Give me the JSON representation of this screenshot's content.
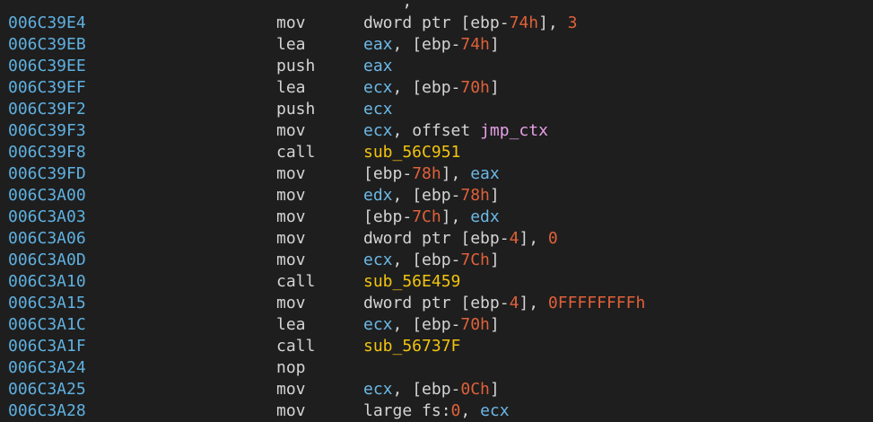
{
  "colors": {
    "background": "#1e1e1e",
    "address": "#5fb0e0",
    "mnemonic": "#d4d4d4",
    "register": "#6cb8e6",
    "number": "#e0613a",
    "subroutine": "#f2c40f",
    "symbol": "#e6a0e6"
  },
  "disasm": {
    "lines": [
      {
        "addr": "",
        "mnem": "",
        "ops": [
          {
            "t": "    ,     ",
            "c": "plain"
          }
        ]
      },
      {
        "addr": "006C39E4",
        "mnem": "mov",
        "ops": [
          {
            "t": "dword ptr [ebp-",
            "c": "plain"
          },
          {
            "t": "74h",
            "c": "num"
          },
          {
            "t": "], ",
            "c": "plain"
          },
          {
            "t": "3",
            "c": "num"
          }
        ]
      },
      {
        "addr": "006C39EB",
        "mnem": "lea",
        "ops": [
          {
            "t": "eax",
            "c": "reg"
          },
          {
            "t": ", [ebp-",
            "c": "plain"
          },
          {
            "t": "74h",
            "c": "num"
          },
          {
            "t": "]",
            "c": "plain"
          }
        ]
      },
      {
        "addr": "006C39EE",
        "mnem": "push",
        "ops": [
          {
            "t": "eax",
            "c": "reg"
          }
        ]
      },
      {
        "addr": "006C39EF",
        "mnem": "lea",
        "ops": [
          {
            "t": "ecx",
            "c": "reg"
          },
          {
            "t": ", [ebp-",
            "c": "plain"
          },
          {
            "t": "70h",
            "c": "num"
          },
          {
            "t": "]",
            "c": "plain"
          }
        ]
      },
      {
        "addr": "006C39F2",
        "mnem": "push",
        "ops": [
          {
            "t": "ecx",
            "c": "reg"
          }
        ]
      },
      {
        "addr": "006C39F3",
        "mnem": "mov",
        "ops": [
          {
            "t": "ecx",
            "c": "reg"
          },
          {
            "t": ", offset ",
            "c": "plain"
          },
          {
            "t": "jmp_ctx",
            "c": "sym"
          }
        ]
      },
      {
        "addr": "006C39F8",
        "mnem": "call",
        "ops": [
          {
            "t": "sub_56C951",
            "c": "sub"
          }
        ]
      },
      {
        "addr": "006C39FD",
        "mnem": "mov",
        "ops": [
          {
            "t": "[ebp-",
            "c": "plain"
          },
          {
            "t": "78h",
            "c": "num"
          },
          {
            "t": "], ",
            "c": "plain"
          },
          {
            "t": "eax",
            "c": "reg"
          }
        ]
      },
      {
        "addr": "006C3A00",
        "mnem": "mov",
        "ops": [
          {
            "t": "edx",
            "c": "reg"
          },
          {
            "t": ", [ebp-",
            "c": "plain"
          },
          {
            "t": "78h",
            "c": "num"
          },
          {
            "t": "]",
            "c": "plain"
          }
        ]
      },
      {
        "addr": "006C3A03",
        "mnem": "mov",
        "ops": [
          {
            "t": "[ebp-",
            "c": "plain"
          },
          {
            "t": "7Ch",
            "c": "num"
          },
          {
            "t": "], ",
            "c": "plain"
          },
          {
            "t": "edx",
            "c": "reg"
          }
        ]
      },
      {
        "addr": "006C3A06",
        "mnem": "mov",
        "ops": [
          {
            "t": "dword ptr [ebp-",
            "c": "plain"
          },
          {
            "t": "4",
            "c": "num"
          },
          {
            "t": "], ",
            "c": "plain"
          },
          {
            "t": "0",
            "c": "num"
          }
        ]
      },
      {
        "addr": "006C3A0D",
        "mnem": "mov",
        "ops": [
          {
            "t": "ecx",
            "c": "reg"
          },
          {
            "t": ", [ebp-",
            "c": "plain"
          },
          {
            "t": "7Ch",
            "c": "num"
          },
          {
            "t": "]",
            "c": "plain"
          }
        ]
      },
      {
        "addr": "006C3A10",
        "mnem": "call",
        "ops": [
          {
            "t": "sub_56E459",
            "c": "sub"
          }
        ]
      },
      {
        "addr": "006C3A15",
        "mnem": "mov",
        "ops": [
          {
            "t": "dword ptr [ebp-",
            "c": "plain"
          },
          {
            "t": "4",
            "c": "num"
          },
          {
            "t": "], ",
            "c": "plain"
          },
          {
            "t": "0FFFFFFFFh",
            "c": "num"
          }
        ]
      },
      {
        "addr": "006C3A1C",
        "mnem": "lea",
        "ops": [
          {
            "t": "ecx",
            "c": "reg"
          },
          {
            "t": ", [ebp-",
            "c": "plain"
          },
          {
            "t": "70h",
            "c": "num"
          },
          {
            "t": "]",
            "c": "plain"
          }
        ]
      },
      {
        "addr": "006C3A1F",
        "mnem": "call",
        "ops": [
          {
            "t": "sub_56737F",
            "c": "sub"
          }
        ]
      },
      {
        "addr": "006C3A24",
        "mnem": "nop",
        "ops": []
      },
      {
        "addr": "006C3A25",
        "mnem": "mov",
        "ops": [
          {
            "t": "ecx",
            "c": "reg"
          },
          {
            "t": ", [ebp-",
            "c": "plain"
          },
          {
            "t": "0Ch",
            "c": "num"
          },
          {
            "t": "]",
            "c": "plain"
          }
        ]
      },
      {
        "addr": "006C3A28",
        "mnem": "mov",
        "ops": [
          {
            "t": "large fs:",
            "c": "plain"
          },
          {
            "t": "0",
            "c": "num"
          },
          {
            "t": ", ",
            "c": "plain"
          },
          {
            "t": "ecx",
            "c": "reg"
          }
        ]
      }
    ]
  }
}
